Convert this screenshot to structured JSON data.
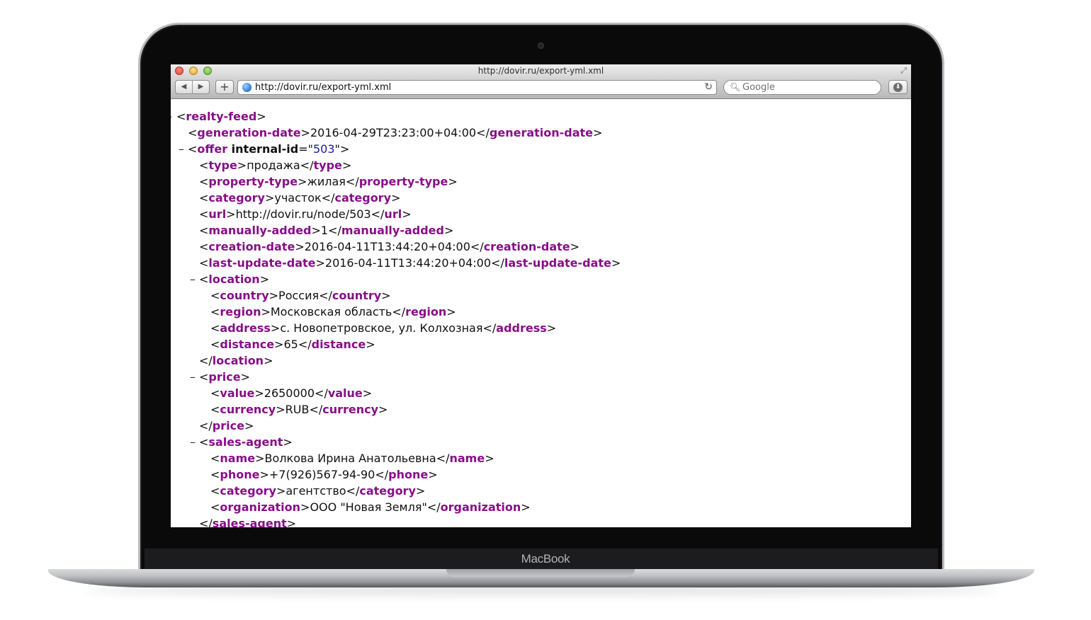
{
  "device": {
    "brand": "MacBook"
  },
  "window": {
    "title": "http://dovir.ru/export-yml.xml"
  },
  "toolbar": {
    "back_icon": "◀",
    "forward_icon": "▶",
    "add_label": "+",
    "url": "http://dovir.ru/export-yml.xml",
    "reload_icon": "↻",
    "search_placeholder": "Google",
    "download_icon": "⬇"
  },
  "xml": {
    "root": {
      "toggle": "-",
      "tag": "realty-feed"
    },
    "generation_date": {
      "tag": "generation-date",
      "value": "2016-04-29T23:23:00+04:00"
    },
    "offer": {
      "toggle": "–",
      "tag": "offer",
      "attr_name": "internal-id",
      "attr_value": "503",
      "fields": [
        {
          "tag": "type",
          "value": "продажа"
        },
        {
          "tag": "property-type",
          "value": "жилая"
        },
        {
          "tag": "category",
          "value": "участок"
        },
        {
          "tag": "url",
          "value": "http://dovir.ru/node/503"
        },
        {
          "tag": "manually-added",
          "value": "1"
        },
        {
          "tag": "creation-date",
          "value": "2016-04-11T13:44:20+04:00"
        },
        {
          "tag": "last-update-date",
          "value": "2016-04-11T13:44:20+04:00"
        }
      ],
      "location": {
        "toggle": "–",
        "tag": "location",
        "fields": [
          {
            "tag": "country",
            "value": "Россия"
          },
          {
            "tag": "region",
            "value": "Московская область"
          },
          {
            "tag": "address",
            "value": "с. Новопетровское, ул. Колхозная"
          },
          {
            "tag": "distance",
            "value": "65"
          }
        ]
      },
      "price": {
        "toggle": "–",
        "tag": "price",
        "fields": [
          {
            "tag": "value",
            "value": "2650000"
          },
          {
            "tag": "currency",
            "value": "RUB"
          }
        ]
      },
      "sales_agent": {
        "toggle": "–",
        "tag": "sales-agent",
        "fields": [
          {
            "tag": "name",
            "value": "Волкова Ирина Анатольевна"
          },
          {
            "tag": "phone",
            "value": "+7(926)567-94-90"
          },
          {
            "tag": "category",
            "value": "агентство"
          },
          {
            "tag": "organization",
            "value": "ООО \"Новая Земля\""
          }
        ]
      }
    }
  }
}
